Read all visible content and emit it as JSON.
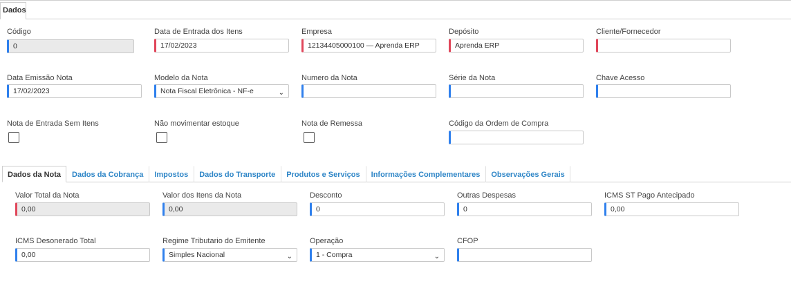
{
  "top_tab": "Dados",
  "fields": {
    "codigo": {
      "label": "Código",
      "value": "0"
    },
    "data_entrada": {
      "label": "Data de Entrada dos Itens",
      "value": "17/02/2023"
    },
    "empresa": {
      "label": "Empresa",
      "value": "12134405000100 — Aprenda ERP"
    },
    "deposito": {
      "label": "Depósito",
      "value": "Aprenda ERP"
    },
    "cliente": {
      "label": "Cliente/Fornecedor",
      "value": ""
    },
    "data_emissao": {
      "label": "Data Emissão Nota",
      "value": "17/02/2023"
    },
    "modelo": {
      "label": "Modelo da Nota",
      "value": "Nota Fiscal Eletrônica - NF-e"
    },
    "numero": {
      "label": "Numero da Nota",
      "value": ""
    },
    "serie": {
      "label": "Série da Nota",
      "value": ""
    },
    "chave": {
      "label": "Chave Acesso",
      "value": ""
    },
    "sem_itens": {
      "label": "Nota de Entrada Sem Itens"
    },
    "nao_mov": {
      "label": "Não movimentar estoque"
    },
    "remessa": {
      "label": "Nota de Remessa"
    },
    "ordem_compra": {
      "label": "Código da Ordem de Compra",
      "value": ""
    }
  },
  "tabs": [
    {
      "label": "Dados da Nota",
      "active": true
    },
    {
      "label": "Dados da Cobrança"
    },
    {
      "label": "Impostos"
    },
    {
      "label": "Dados do Transporte"
    },
    {
      "label": "Produtos e Serviços"
    },
    {
      "label": "Informações Complementares"
    },
    {
      "label": "Observações Gerais"
    }
  ],
  "nota": {
    "valor_total": {
      "label": "Valor Total da Nota",
      "value": "0,00"
    },
    "valor_itens": {
      "label": "Valor dos Itens da Nota",
      "value": "0,00"
    },
    "desconto": {
      "label": "Desconto",
      "value": "0"
    },
    "outras": {
      "label": "Outras Despesas",
      "value": "0"
    },
    "icms_st": {
      "label": "ICMS ST Pago Antecipado",
      "value": "0,00"
    },
    "icms_des": {
      "label": "ICMS Desonerado Total",
      "value": "0,00"
    },
    "regime": {
      "label": "Regime Tributario do Emitente",
      "value": "Simples Nacional"
    },
    "operacao": {
      "label": "Operação",
      "value": "1 - Compra"
    },
    "cfop": {
      "label": "CFOP",
      "value": ""
    }
  },
  "colors": {
    "required": "#e0465a",
    "optional": "#2f80ed",
    "tab_link": "#2f86c7"
  }
}
